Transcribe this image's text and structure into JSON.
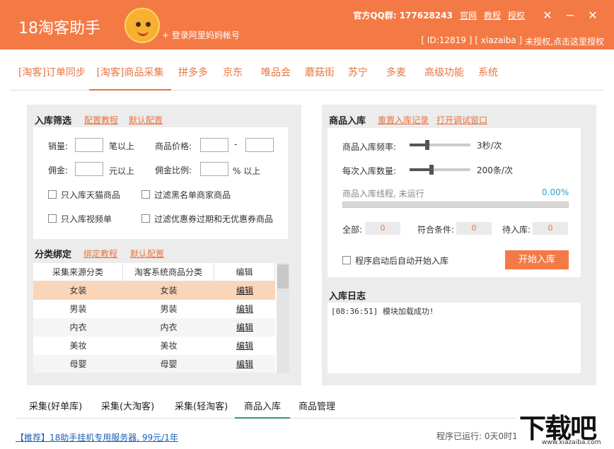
{
  "header": {
    "title": "18淘客助手",
    "login": "+ 登录阿里妈妈帐号",
    "qq": "官方QQ群: 177628243",
    "links": [
      "官网",
      "教程",
      "授权"
    ],
    "tools_icon": "wrench-icon",
    "id_text": "[ ID:12819 ]",
    "user_text": "[ xiazaiba ]",
    "auth_text": "未授权,点击这里授权"
  },
  "nav": {
    "items": [
      "[淘客]订单同步",
      "[淘客]商品采集",
      "拼多多",
      "京东",
      "唯品会",
      "蘑菇街",
      "苏宁",
      "多麦",
      "高级功能",
      "系统"
    ],
    "active": "[淘客]商品采集"
  },
  "filter": {
    "title": "入库筛选",
    "link1": "配置教程",
    "link2": "默认配置",
    "sales_label": "销量:",
    "sales_unit": "笔以上",
    "price_label": "商品价格:",
    "price_dash": "-",
    "commission_label": "佣金:",
    "commission_unit": "元以上",
    "ratio_label": "佣金比例:",
    "ratio_unit": "% 以上",
    "chk1": "只入库天猫商品",
    "chk2": "过滤黑名单商家商品",
    "chk3": "只入库视频单",
    "chk4": "过滤优惠券过期和无优惠券商品"
  },
  "category": {
    "title": "分类绑定",
    "link1": "绑定教程",
    "link2": "默认配置",
    "headers": [
      "采集来源分类",
      "淘客系统商品分类",
      "编辑"
    ],
    "rows": [
      {
        "src": "女装",
        "dst": "女装",
        "edit": "编辑"
      },
      {
        "src": "男装",
        "dst": "男装",
        "edit": "编辑"
      },
      {
        "src": "内衣",
        "dst": "内衣",
        "edit": "编辑"
      },
      {
        "src": "美妆",
        "dst": "美妆",
        "edit": "编辑"
      },
      {
        "src": "母婴",
        "dst": "母婴",
        "edit": "编辑"
      }
    ]
  },
  "import": {
    "title": "商品入库",
    "link1": "重置入库记录",
    "link2": "打开调试窗口",
    "freq_label": "商品入库频率:",
    "freq_value": "3秒/次",
    "count_label": "每次入库数量:",
    "count_value": "200条/次",
    "thread_label": "商品入库线程, 未运行",
    "progress_text": "0.00%",
    "progress": 0,
    "total_label": "全部:",
    "total": "0",
    "match_label": "符合条件:",
    "match": "0",
    "pending_label": "待入库:",
    "pending": "0",
    "auto_start": "程序启动后自动开始入库",
    "start_button": "开始入库"
  },
  "log": {
    "title": "入库日志",
    "lines": [
      "[08:36:51] 模块加载成功!"
    ]
  },
  "bottom_tabs": {
    "items": [
      "采集(好单库)",
      "采集(大淘客)",
      "采集(轻淘客)",
      "商品入库",
      "商品管理"
    ],
    "active": "商品入库"
  },
  "status": {
    "promo": "【推荐】18助手挂机专用服务器, 99元/1年",
    "runtime": "程序已运行: 0天0时1分"
  },
  "watermark": {
    "main": "下载吧",
    "sub": "www.xiazaiba.com"
  },
  "colors": {
    "accent": "#f47a45",
    "selected_row": "#fbd5b8",
    "active_tab_underline": "#2a9d6b"
  }
}
